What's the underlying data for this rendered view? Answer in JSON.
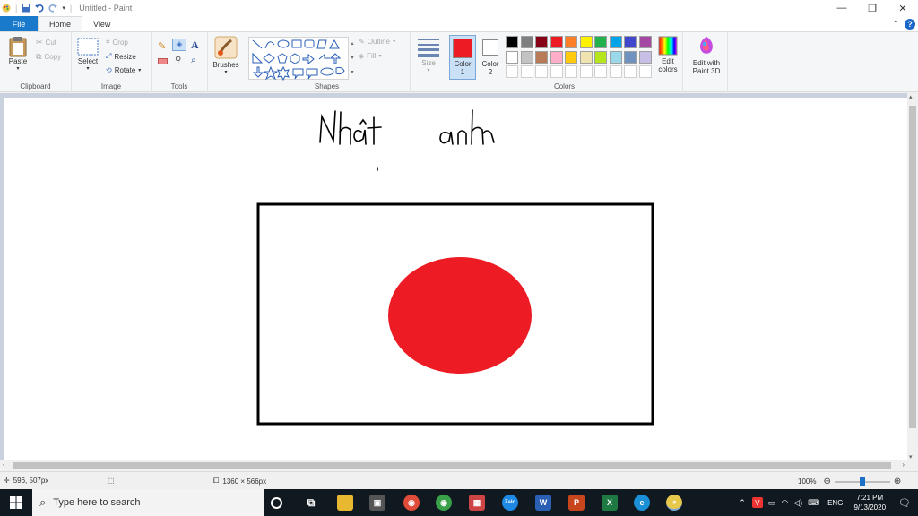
{
  "window": {
    "title": "Untitled - Paint",
    "minimize_glyph": "—",
    "restore_glyph": "❐",
    "close_glyph": "✕"
  },
  "tabs": {
    "file": "File",
    "home": "Home",
    "view": "View"
  },
  "ribbon": {
    "clipboard": {
      "label": "Clipboard",
      "paste": "Paste",
      "cut": "Cut",
      "copy": "Copy"
    },
    "image": {
      "label": "Image",
      "select": "Select",
      "crop": "Crop",
      "resize": "Resize",
      "rotate": "Rotate"
    },
    "tools": {
      "label": "Tools"
    },
    "brushes": {
      "label": "Brushes"
    },
    "shapes": {
      "label": "Shapes",
      "outline": "Outline",
      "fill": "Fill"
    },
    "size": {
      "label": "Size"
    },
    "colors": {
      "label": "Colors",
      "color1": "Color\n1",
      "color1_value": "#ed1c24",
      "color2": "Color\n2",
      "color2_value": "#ffffff",
      "edit_colors": "Edit\ncolors",
      "palette_row1": [
        "#000000",
        "#7f7f7f",
        "#880015",
        "#ed1c24",
        "#ff7f27",
        "#fff200",
        "#22b14c",
        "#00a2e8",
        "#3f48cc",
        "#a349a4"
      ],
      "palette_row2": [
        "#ffffff",
        "#c3c3c3",
        "#b97a57",
        "#ffaec9",
        "#ffc90e",
        "#efe4b0",
        "#b5e61d",
        "#99d9ea",
        "#7092be",
        "#c8bfe7"
      ]
    },
    "paint3d": {
      "label": "Edit with\nPaint 3D"
    }
  },
  "canvas": {
    "handwriting": [
      "Nhật",
      "anh"
    ],
    "flag_border": "#000000",
    "flag_disc": "#ed1c24"
  },
  "status": {
    "cursor_pos": "596, 507px",
    "image_size": "1360 × 566px",
    "zoom": "100%",
    "zoom_level": 0.5
  },
  "taskbar": {
    "search_placeholder": "Type here to search",
    "language": "ENG",
    "time": "7:21 PM",
    "date": "9/13/2020"
  }
}
